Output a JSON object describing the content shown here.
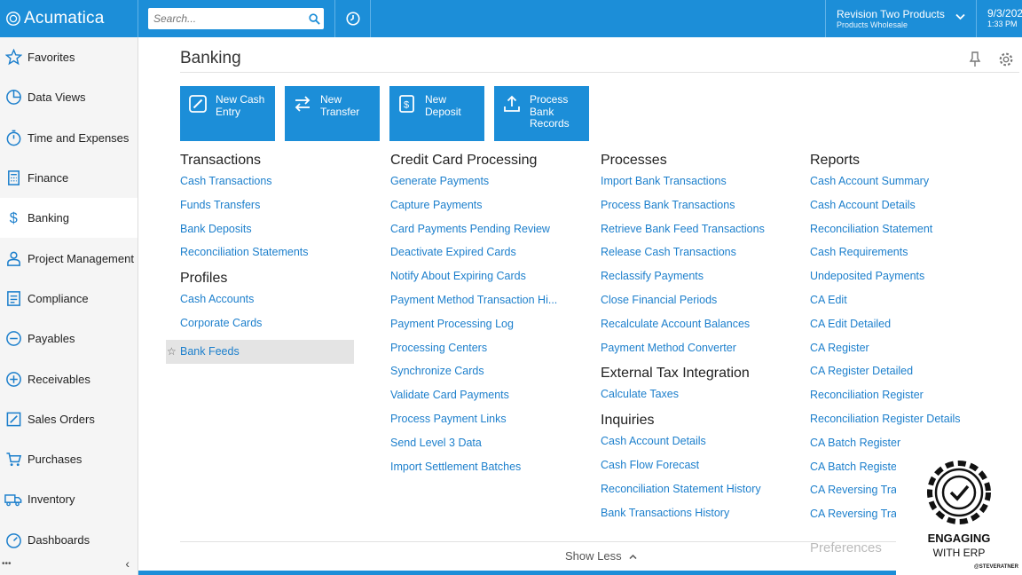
{
  "app": {
    "name": "Acumatica"
  },
  "topbar": {
    "search_placeholder": "Search...",
    "company_name": "Revision Two Products",
    "branch_name": "Products Wholesale",
    "date": "9/3/202",
    "time": "1:33 PM"
  },
  "sidebar": {
    "items": [
      {
        "label": "Favorites",
        "icon": "star-icon"
      },
      {
        "label": "Data Views",
        "icon": "pie-chart-icon"
      },
      {
        "label": "Time and Expenses",
        "icon": "stopwatch-icon"
      },
      {
        "label": "Finance",
        "icon": "calculator-icon"
      },
      {
        "label": "Banking",
        "icon": "dollar-icon",
        "active": true
      },
      {
        "label": "Project Management",
        "icon": "person-icon"
      },
      {
        "label": "Compliance",
        "icon": "checklist-icon"
      },
      {
        "label": "Payables",
        "icon": "minus-circle-icon"
      },
      {
        "label": "Receivables",
        "icon": "plus-circle-icon"
      },
      {
        "label": "Sales Orders",
        "icon": "edit-icon"
      },
      {
        "label": "Purchases",
        "icon": "cart-icon"
      },
      {
        "label": "Inventory",
        "icon": "truck-icon"
      },
      {
        "label": "Dashboards",
        "icon": "gauge-icon"
      }
    ],
    "more": "•••",
    "collapse": "‹"
  },
  "main": {
    "title": "Banking",
    "tiles": [
      {
        "label": "New Cash Entry"
      },
      {
        "label": "New Transfer"
      },
      {
        "label": "New Deposit"
      },
      {
        "label": "Process Bank Records"
      }
    ],
    "transactions": {
      "title": "Transactions",
      "links": [
        "Cash Transactions",
        "Funds Transfers",
        "Bank Deposits",
        "Reconciliation Statements"
      ]
    },
    "profiles": {
      "title": "Profiles",
      "links": [
        "Cash Accounts",
        "Corporate Cards",
        "Bank Feeds"
      ]
    },
    "credit_card": {
      "title": "Credit Card Processing",
      "links": [
        "Generate Payments",
        "Capture Payments",
        "Card Payments Pending Review",
        "Deactivate Expired Cards",
        "Notify About Expiring Cards",
        "Payment Method Transaction Hi...",
        "Payment Processing Log",
        "Processing Centers",
        "Synchronize Cards",
        "Validate Card Payments",
        "Process Payment Links",
        "Send Level 3 Data",
        "Import Settlement Batches"
      ]
    },
    "processes": {
      "title": "Processes",
      "links": [
        "Import Bank Transactions",
        "Process Bank Transactions",
        "Retrieve Bank Feed Transactions",
        "Release Cash Transactions",
        "Reclassify Payments",
        "Close Financial Periods",
        "Recalculate Account Balances",
        "Payment Method Converter"
      ]
    },
    "external_tax": {
      "title": "External Tax Integration",
      "links": [
        "Calculate Taxes"
      ]
    },
    "inquiries": {
      "title": "Inquiries",
      "links": [
        "Cash Account Details",
        "Cash Flow Forecast",
        "Reconciliation Statement History",
        "Bank Transactions History"
      ]
    },
    "reports": {
      "title": "Reports",
      "links": [
        "Cash Account Summary",
        "Cash Account Details",
        "Reconciliation Statement",
        "Cash Requirements",
        "Undeposited Payments",
        "CA Edit",
        "CA Edit Detailed",
        "CA Register",
        "CA Register Detailed",
        "Reconciliation Register",
        "Reconciliation Register Details",
        "CA Batch Register",
        "CA Batch Registe",
        "CA Reversing Tra",
        "CA Reversing Tra"
      ]
    },
    "preferences_faded": "Preferences",
    "show_less": "Show Less"
  },
  "watermark": {
    "line1": "ENGAGING",
    "line2": "WITH ERP",
    "handle": "@STEVERATNER"
  },
  "colors": {
    "brand_blue": "#1c8ed8",
    "link_blue": "#1c7fcc"
  }
}
